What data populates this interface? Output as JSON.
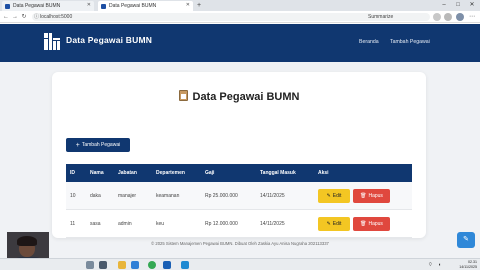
{
  "browser": {
    "tabs": [
      {
        "label": "Data Pegawai BUMN",
        "active": false
      },
      {
        "label": "Data Pegawai BUMN",
        "active": true
      }
    ],
    "new_tab": "+",
    "url": "localhost:5000",
    "summarize_label": "Summarize",
    "window_controls": [
      "–",
      "□",
      "✕"
    ]
  },
  "navbar": {
    "brand": "Data Pegawai BUMN",
    "links": [
      "Beranda",
      "Tambah Pegawai"
    ],
    "bg_color": "#103770"
  },
  "card": {
    "title": "Data Pegawai BUMN",
    "add_button": "Tambah Pegawai"
  },
  "table": {
    "headers": [
      "ID",
      "Nama",
      "Jabatan",
      "Departemen",
      "Gaji",
      "Tanggal Masuk",
      "Aksi"
    ],
    "rows": [
      {
        "id": "10",
        "nama": "daka",
        "jabatan": "manajer",
        "departemen": "keamanan",
        "gaji": "Rp 25.000.000",
        "tanggal": "14/11/2025"
      },
      {
        "id": "11",
        "nama": "sasa",
        "jabatan": "admin",
        "departemen": "keu",
        "gaji": "Rp 12.000.000",
        "tanggal": "14/11/2025"
      }
    ],
    "edit_label": "Edit",
    "delete_label": "Hapus",
    "edit_color": "#f3c623",
    "delete_color": "#e0483e"
  },
  "footer": {
    "text": "© 2025 Sistem Manajemen Pegawai BUMN. Dibuat Oleh Zaskia Ayu Anisa Nugraha 202113337"
  },
  "taskbar": {
    "time": "02.31",
    "date": "14/11/2025"
  }
}
